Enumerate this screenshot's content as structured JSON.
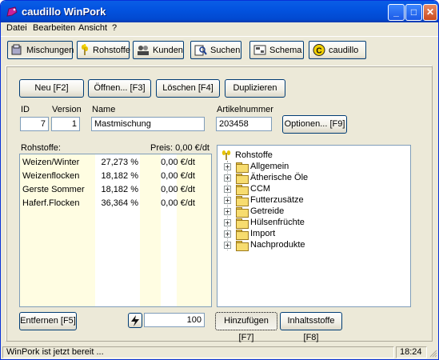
{
  "window": {
    "title": "caudillo WinPork"
  },
  "menu": [
    "Datei",
    "Bearbeiten",
    "Ansicht",
    "?"
  ],
  "toolbar": {
    "tabs": [
      {
        "label": "Mischungen",
        "icon": "mixing-icon"
      },
      {
        "label": "Rohstoffe",
        "icon": "wheat-icon"
      },
      {
        "label": "Kunden",
        "icon": "customers-icon"
      },
      {
        "label": "Suchen",
        "icon": "search-icon"
      },
      {
        "label": "Schema",
        "icon": "schema-icon"
      },
      {
        "label": "caudillo",
        "icon": "caudillo-logo-icon"
      }
    ]
  },
  "actions": {
    "new": "Neu [F2]",
    "open": "Öffnen... [F3]",
    "delete": "Löschen [F4]",
    "duplicate": "Duplizieren"
  },
  "form": {
    "id_label": "ID",
    "id_value": "7",
    "version_label": "Version",
    "version_value": "1",
    "name_label": "Name",
    "name_value": "Mastmischung",
    "article_label": "Artikelnummer",
    "article_value": "203458",
    "options_button": "Optionen... [F9]"
  },
  "ingredients": {
    "label": "Rohstoffe:",
    "price_label": "Preis: 0,00 €/dt",
    "rows": [
      {
        "name": "Weizen/Winter",
        "percent": "27,273 %",
        "price": "0,00 €/dt"
      },
      {
        "name": "Weizenflocken",
        "percent": "18,182 %",
        "price": "0,00 €/dt"
      },
      {
        "name": "Gerste Sommer",
        "percent": "18,182 %",
        "price": "0,00 €/dt"
      },
      {
        "name": "Haferf.Flocken",
        "percent": "36,364 %",
        "price": "0,00 €/dt"
      }
    ],
    "remove_button": "Entfernen [F5]",
    "amount_value": "100"
  },
  "tree": {
    "root": "Rohstoffe",
    "items": [
      "Allgemein",
      "Ätherische Öle",
      "CCM",
      "Futterzusätze",
      "Getreide",
      "Hülsenfrüchte",
      "Import",
      "Nachprodukte"
    ],
    "add_button": "Hinzufügen [F7]",
    "contents_button": "Inhaltsstoffe [F8]"
  },
  "status": {
    "message": "WinPork ist jetzt bereit ...",
    "time": "18:24"
  },
  "colors": {
    "titlebar": "#0353e0",
    "window_bg": "#ece9d8",
    "grid_col_highlight": "#fffde0",
    "field_border": "#7f9db9"
  }
}
